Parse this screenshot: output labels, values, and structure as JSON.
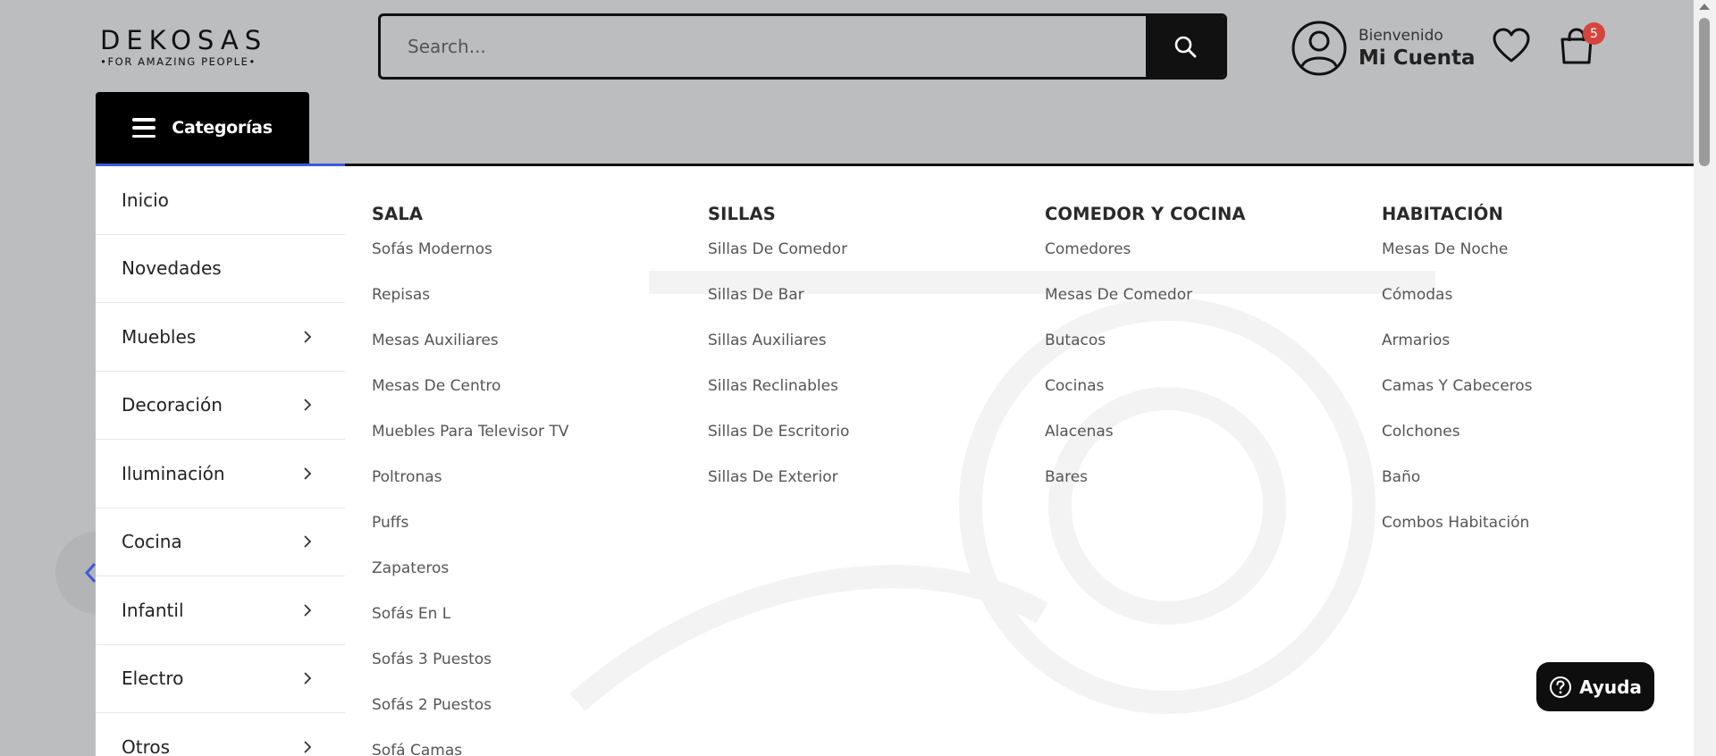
{
  "header": {
    "logo_text": "DEKOSAS",
    "logo_tagline": "•FOR AMAZING PEOPLE•",
    "search_placeholder": "Search...",
    "account_greeting": "Bienvenido",
    "account_name": "Mi Cuenta",
    "cart_count": "5",
    "categories_label": "Categorías"
  },
  "sidebar": {
    "items": [
      {
        "label": "Inicio",
        "has_submenu": false
      },
      {
        "label": "Novedades",
        "has_submenu": false
      },
      {
        "label": "Muebles",
        "has_submenu": true
      },
      {
        "label": "Decoración",
        "has_submenu": true
      },
      {
        "label": "Iluminación",
        "has_submenu": true
      },
      {
        "label": "Cocina",
        "has_submenu": true
      },
      {
        "label": "Infantil",
        "has_submenu": true
      },
      {
        "label": "Electro",
        "has_submenu": true
      },
      {
        "label": "Otros",
        "has_submenu": true
      }
    ]
  },
  "mega_menu": {
    "columns": [
      {
        "title": "SALA",
        "links": [
          "Sofás Modernos",
          "Repisas",
          "Mesas Auxiliares",
          "Mesas De Centro",
          "Muebles Para Televisor TV",
          "Poltronas",
          "Puffs",
          "Zapateros",
          "Sofás En L",
          "Sofás 3 Puestos",
          "Sofás 2 Puestos",
          "Sofá Camas"
        ]
      },
      {
        "title": "SILLAS",
        "links": [
          "Sillas De Comedor",
          "Sillas De Bar",
          "Sillas Auxiliares",
          "Sillas Reclinables",
          "Sillas De Escritorio",
          "Sillas De Exterior"
        ]
      },
      {
        "title": "COMEDOR Y COCINA",
        "links": [
          "Comedores",
          "Mesas De Comedor",
          "Butacos",
          "Cocinas",
          "Alacenas",
          "Bares"
        ]
      },
      {
        "title": "HABITACIÓN",
        "links": [
          "Mesas De Noche",
          "Cómodas",
          "Armarios",
          "Camas Y Cabeceros",
          "Colchones",
          "Baño",
          "Combos Habitación"
        ]
      }
    ]
  },
  "help": {
    "label": "Ayuda"
  },
  "colors": {
    "accent_blue": "#3b5bdb",
    "badge_red": "#d6453d",
    "overlay_gray": "#bcbdbf",
    "dark": "#0e0e0e"
  },
  "icons": [
    "search-icon",
    "user-circle-icon",
    "heart-icon",
    "shopping-bag-icon",
    "hamburger-icon",
    "chevron-right-icon",
    "chevron-left-icon",
    "question-circle-icon"
  ]
}
